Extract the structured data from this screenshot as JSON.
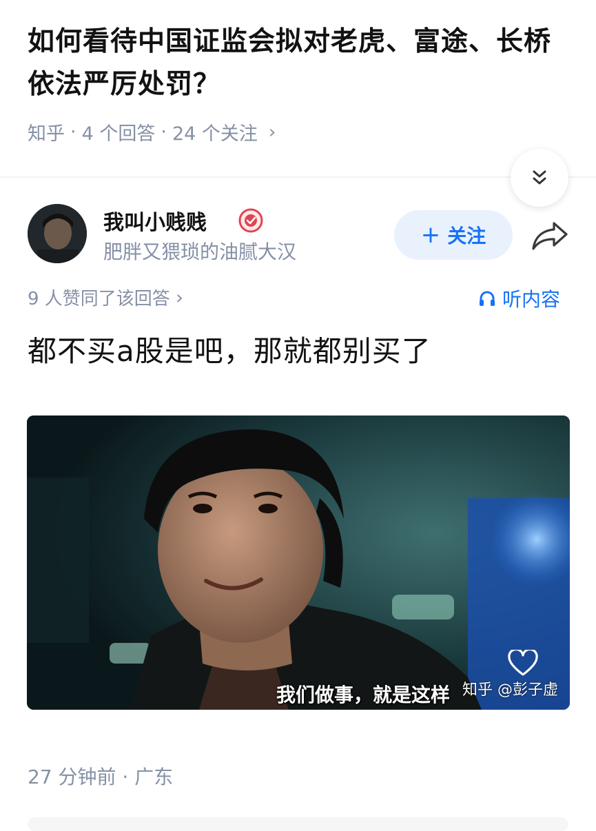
{
  "question": {
    "title": "如何看待中国证监会拟对老虎、富途、长桥依法严厉处罚？",
    "source": "知乎",
    "answers_count": "4 个回答",
    "followers_count": "24 个关注"
  },
  "author": {
    "name": "我叫小贱贱",
    "bio": "肥胖又猥琐的油腻大汉",
    "follow_label": "关注"
  },
  "answer": {
    "upvote_text": "9 人赞同了该回答",
    "listen_label": "听内容",
    "text": "都不买a股是吧，那就都别买了",
    "image_subtitle": "我们做事，就是这样",
    "image_watermark": "知乎 @彭子虚",
    "time_location": "27 分钟前 · 广东"
  },
  "colors": {
    "accent": "#1772f6",
    "muted": "#8590a6",
    "badge": "#e0454f"
  },
  "icons": [
    "chevron-right-icon",
    "double-chevron-down-icon",
    "verified-badge-icon",
    "plus-icon",
    "share-icon",
    "headphones-icon",
    "heart-icon"
  ]
}
